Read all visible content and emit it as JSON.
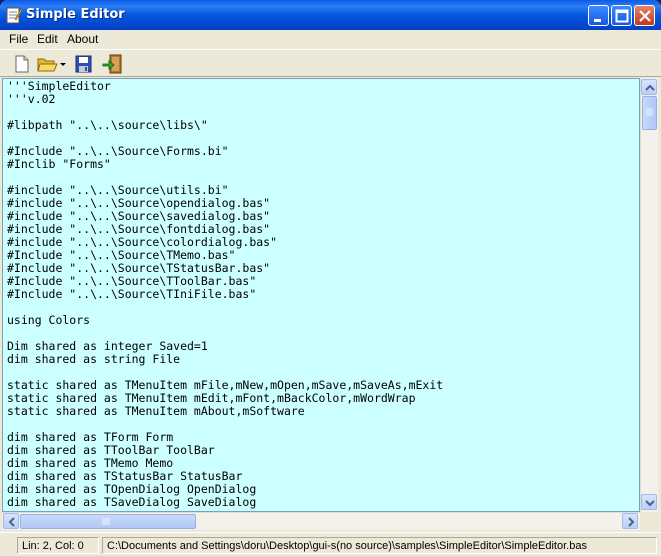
{
  "window": {
    "title": "Simple Editor"
  },
  "menu": {
    "file": "File",
    "edit": "Edit",
    "about": "About"
  },
  "toolbar": {
    "icons": [
      "new-file-icon",
      "open-folder-icon",
      "dropdown-arrow-icon",
      "save-icon",
      "exit-icon"
    ]
  },
  "editor": {
    "background": "#ccffff",
    "lines": [
      "'''SimpleEditor",
      "'''v.02",
      "",
      "#libpath \"..\\..\\source\\libs\\\"",
      "",
      "#Include \"..\\..\\Source\\Forms.bi\"",
      "#Inclib \"Forms\"",
      "",
      "#include \"..\\..\\Source\\utils.bi\"",
      "#include \"..\\..\\Source\\opendialog.bas\"",
      "#include \"..\\..\\Source\\savedialog.bas\"",
      "#include \"..\\..\\Source\\fontdialog.bas\"",
      "#include \"..\\..\\Source\\colordialog.bas\"",
      "#Include \"..\\..\\Source\\TMemo.bas\"",
      "#Include \"..\\..\\Source\\TStatusBar.bas\"",
      "#Include \"..\\..\\Source\\TToolBar.bas\"",
      "#Include \"..\\..\\Source\\TIniFile.bas\"",
      "",
      "using Colors",
      "",
      "Dim shared as integer Saved=1",
      "dim shared as string File",
      "",
      "static shared as TMenuItem mFile,mNew,mOpen,mSave,mSaveAs,mExit",
      "static shared as TMenuItem mEdit,mFont,mBackColor,mWordWrap",
      "static shared as TMenuItem mAbout,mSoftware",
      "",
      "dim shared as TForm Form",
      "dim shared as TToolBar ToolBar",
      "dim shared as TMemo Memo",
      "dim shared as TStatusBar StatusBar",
      "dim shared as TOpenDialog OpenDialog",
      "dim shared as TSaveDialog SaveDialog"
    ]
  },
  "status": {
    "position": "Lin: 2, Col: 0",
    "path": "C:\\Documents and Settings\\doru\\Desktop\\gui-s(no source)\\samples\\SimpleEditor\\SimpleEditor.bas"
  }
}
